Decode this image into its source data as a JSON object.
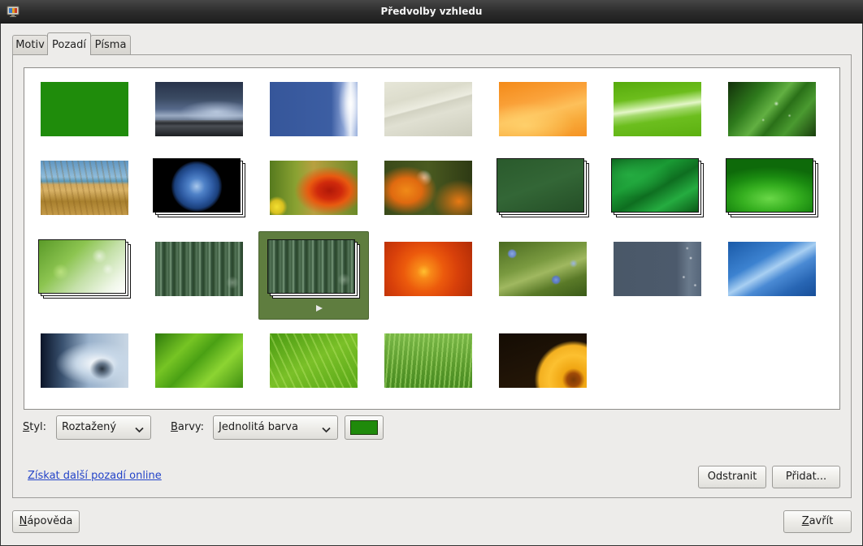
{
  "window": {
    "title": "Předvolby vzhledu",
    "app_icon": "appearance-preferences-icon"
  },
  "tabs": [
    {
      "label": "Motiv",
      "selected": false
    },
    {
      "label": "Pozadí",
      "selected": true
    },
    {
      "label": "Písma",
      "selected": false
    }
  ],
  "background_grid": {
    "wallpapers": [
      {
        "slideshow": false
      },
      {
        "slideshow": false
      },
      {
        "slideshow": false
      },
      {
        "slideshow": false
      },
      {
        "slideshow": false
      },
      {
        "slideshow": false
      },
      {
        "slideshow": false
      },
      {
        "slideshow": false
      },
      {
        "slideshow": true
      },
      {
        "slideshow": false
      },
      {
        "slideshow": false
      },
      {
        "slideshow": true
      },
      {
        "slideshow": true
      },
      {
        "slideshow": true
      },
      {
        "slideshow": true
      },
      {
        "slideshow": false
      },
      {
        "slideshow": true
      },
      {
        "slideshow": false
      },
      {
        "slideshow": false
      },
      {
        "slideshow": false
      },
      {
        "slideshow": false
      },
      {
        "slideshow": false
      },
      {
        "slideshow": false
      },
      {
        "slideshow": false
      },
      {
        "slideshow": false
      },
      {
        "slideshow": false
      }
    ],
    "selected_index": 16,
    "selected_overlay_icon": "play-icon"
  },
  "style": {
    "label": "Styl:",
    "value": "Roztažený",
    "icon": "chevron-down-icon"
  },
  "colors": {
    "label": "Barvy:",
    "value": "Jednolitá barva",
    "icon": "chevron-down-icon",
    "primary_color": "#1f8a0b"
  },
  "online_link": {
    "text": "Získat další pozadí online"
  },
  "buttons": {
    "remove": "Odstranit",
    "add": "Přidat...",
    "help": "Nápověda",
    "close": "Zavřít"
  },
  "theme": {
    "selection_color": "#5f7d3f",
    "link_color": "#2343c8"
  }
}
